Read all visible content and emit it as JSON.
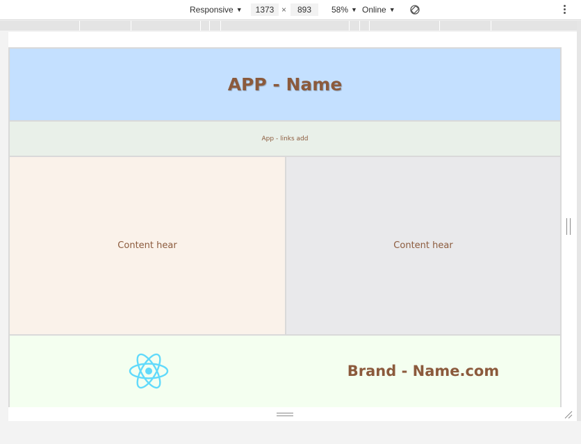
{
  "toolbar": {
    "device": "Responsive",
    "width": "1373",
    "times": "×",
    "height": "893",
    "zoom": "58%",
    "network": "Online",
    "icons": [
      "caret-down-icon",
      "rotate-icon",
      "more-vert-icon"
    ]
  },
  "app": {
    "title": "APP - Name",
    "links": "App - links add",
    "content_left": "Content hear",
    "content_right": "Content hear",
    "brand": "Brand - Name.com",
    "logo": "react-logo-icon"
  },
  "colors": {
    "header_bg": "#c4e0ff",
    "links_bg": "#e9f0e9",
    "left_bg": "#faf2ea",
    "right_bg": "#e9e9eb",
    "footer_bg": "#f4fff0",
    "text_brown": "#8b5a3c",
    "react_blue": "#61dafb"
  }
}
